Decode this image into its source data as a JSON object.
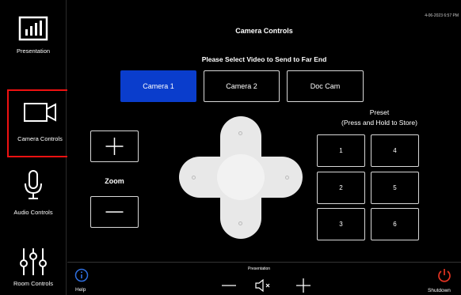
{
  "timestamp": "4-06-2023 6:57 PM",
  "sidebar": {
    "items": [
      {
        "label": "Presentation",
        "icon": "presentation-chart-icon"
      },
      {
        "label": "Camera Controls",
        "icon": "camera-icon",
        "selected": true
      },
      {
        "label": "Audio Controls",
        "icon": "microphone-icon"
      },
      {
        "label": "Room Controls",
        "icon": "sliders-icon"
      }
    ]
  },
  "main": {
    "title": "Camera Controls",
    "subtitle": "Please Select Video to Send to Far End",
    "sources": [
      {
        "label": "Camera 1",
        "active": true
      },
      {
        "label": "Camera 2",
        "active": false
      },
      {
        "label": "Doc Cam",
        "active": false
      }
    ],
    "zoom_label": "Zoom",
    "preset_heading_1": "Preset",
    "preset_heading_2": "(Press and Hold to Store)",
    "presets": [
      "1",
      "4",
      "2",
      "5",
      "3",
      "6"
    ]
  },
  "bottom": {
    "presentation_label": "Presentation",
    "help_label": "Help",
    "shutdown_label": "Shutdown"
  },
  "colors": {
    "accent_blue": "#0a3dcc",
    "selected_border": "#ee1111",
    "shutdown_red": "#e33322",
    "help_blue": "#2f6fe0"
  }
}
